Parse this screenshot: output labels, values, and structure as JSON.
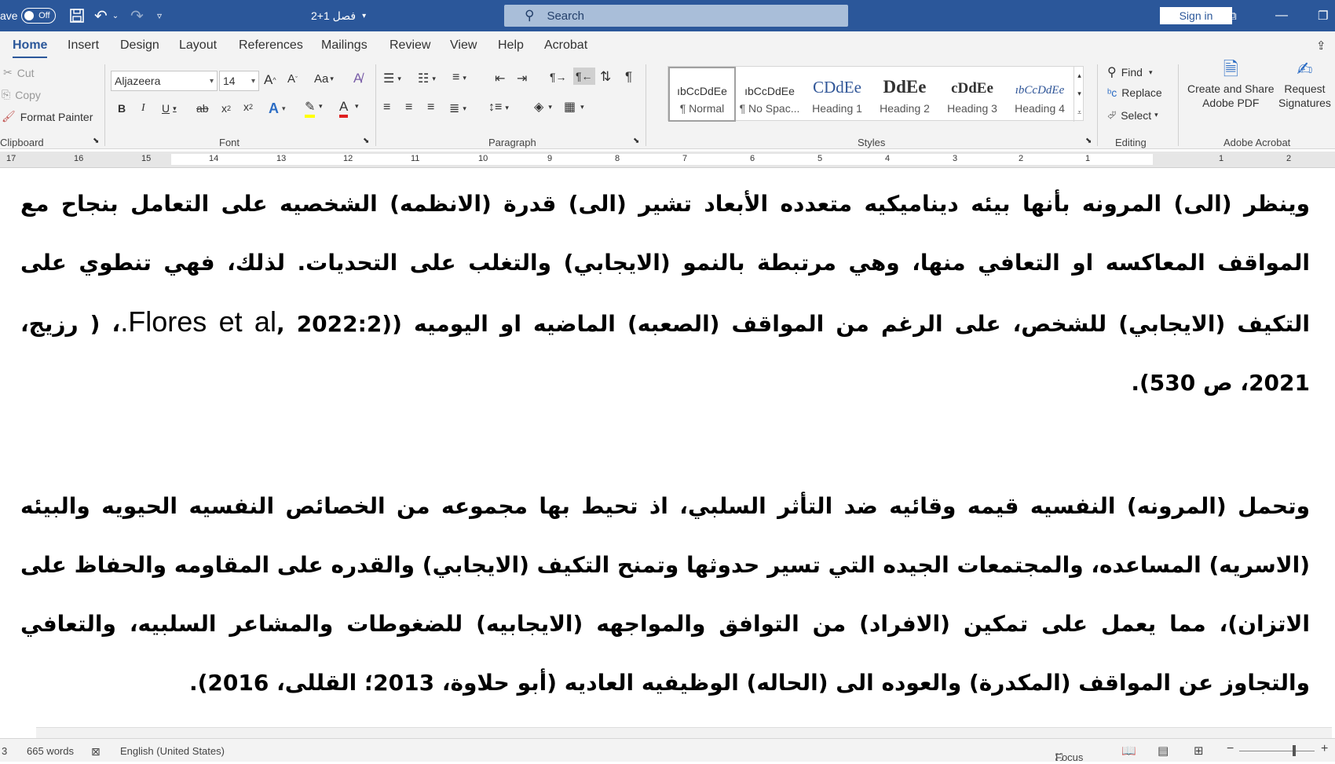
{
  "titlebar": {
    "autosave_label": "ave",
    "autosave_state": "Off",
    "doc_title": "2+1 فصل",
    "search_placeholder": "Search",
    "signin_label": "Sign in"
  },
  "tabs": [
    "Home",
    "Insert",
    "Design",
    "Layout",
    "References",
    "Mailings",
    "Review",
    "View",
    "Help",
    "Acrobat"
  ],
  "clipboard": {
    "cut": "Cut",
    "copy": "Copy",
    "format_painter": "Format Painter",
    "label": "Clipboard"
  },
  "font": {
    "name": "Aljazeera",
    "size": "14",
    "label": "Font"
  },
  "paragraph": {
    "label": "Paragraph"
  },
  "styles": {
    "label": "Styles",
    "items": [
      {
        "preview": "ıbCcDdEe",
        "name": "¶ Normal"
      },
      {
        "preview": "ıbCcDdEe",
        "name": "¶ No Spac..."
      },
      {
        "preview": "CDdEe",
        "name": "Heading 1"
      },
      {
        "preview": "DdEe",
        "name": "Heading 2"
      },
      {
        "preview": "cDdEe",
        "name": "Heading 3"
      },
      {
        "preview": "ıbCcDdEe",
        "name": "Heading 4"
      }
    ]
  },
  "editing": {
    "find": "Find",
    "replace": "Replace",
    "select": "Select",
    "label": "Editing"
  },
  "acrobat": {
    "create_line1": "Create and Share",
    "create_line2": "Adobe PDF",
    "request_line1": "Request",
    "request_line2": "Signatures",
    "label": "Adobe Acrobat"
  },
  "ruler": {
    "numbers": [
      "17",
      "16",
      "15",
      "14",
      "13",
      "12",
      "11",
      "10",
      "9",
      "8",
      "7",
      "6",
      "5",
      "4",
      "3",
      "2",
      "1",
      "1",
      "2"
    ]
  },
  "document": {
    "para1_a": "وينظر (الى) المرونه بأنها بيئه ديناميكيه متعدده الأبعاد تشير (الى) قدرة (الانظمه) الشخصيه على التعامل بنجاح مع المواقف المعاكسه او التعافي منها، وهي مرتبطة بالنمو (الايجابي) والتغلب على التحديات. لذلك، فهي تنطوي على التكيف (الايجابي) للشخص، على الرغم من المواقف (الصعبه) الماضيه او اليوميه ((2022:2 ,",
    "para1_latin": "Flores et al.",
    "para1_b": "، ( رزيج، 2021، ص 530).",
    "para2": "وتحمل (المرونه) النفسيه قيمه وقائيه ضد التأثر السلبي، اذ تحيط بها مجموعه من الخصائص النفسيه الحيويه والبيئه (الاسريه) المساعده، والمجتمعات الجيده التي تسير حدوثها وتمنح التكيف (الايجابي) والقدره على المقاومه والحفاظ على الاتزان)، مما يعمل على تمكين (الافراد) من التوافق والمواجهه (الايجابيه) للضغوطات والمشاعر السلبيه، والتعافي والتجاوز عن المواقف (المكدرة) والعوده الى (الحاله) الوظيفيه العاديه (أبو حلاوة، 2013؛ القللى، 2016)."
  },
  "status": {
    "page": "3",
    "words": "665 words",
    "language": "English (United States)",
    "focus": "Focus"
  }
}
